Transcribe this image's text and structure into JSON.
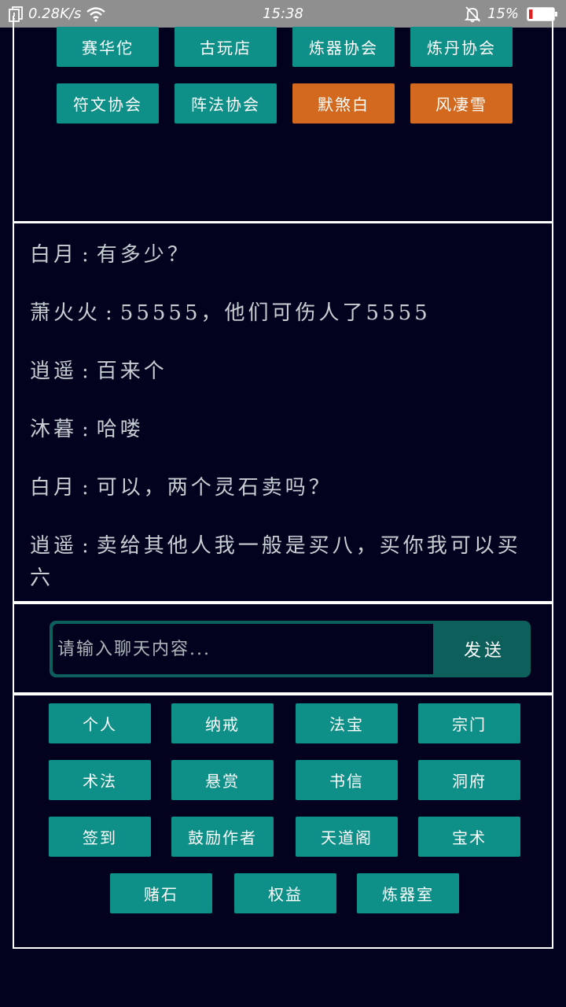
{
  "status_bar": {
    "speed": "0.28K/s",
    "time": "15:38",
    "battery_pct": "15%",
    "battery_level": 0.15,
    "battery_color": "#e02020",
    "icons": [
      "data-saver-icon",
      "wifi-icon",
      "bell-muted-icon",
      "battery-icon"
    ]
  },
  "top_buttons": [
    {
      "label": "赛华佗",
      "color": "#0e8f87"
    },
    {
      "label": "古玩店",
      "color": "#0e8f87"
    },
    {
      "label": "炼器协会",
      "color": "#0e8f87"
    },
    {
      "label": "炼丹协会",
      "color": "#0e8f87"
    },
    {
      "label": "符文协会",
      "color": "#0e8f87"
    },
    {
      "label": "阵法协会",
      "color": "#0e8f87"
    },
    {
      "label": "默煞白",
      "color": "#d2691e"
    },
    {
      "label": "风凄雪",
      "color": "#d2691e"
    }
  ],
  "chat": {
    "separator": ":",
    "messages": [
      {
        "speaker": "白月",
        "text": "有多少？"
      },
      {
        "speaker": "萧火火",
        "text": "55555，他们可伤人了5555"
      },
      {
        "speaker": "逍遥",
        "text": "百来个"
      },
      {
        "speaker": "沐暮",
        "text": "哈喽"
      },
      {
        "speaker": "白月",
        "text": "可以，两个灵石卖吗？"
      },
      {
        "speaker": "逍遥",
        "text": "卖给其他人我一般是买八，买你我可以买六"
      }
    ]
  },
  "input": {
    "placeholder": "请输入聊天内容...",
    "value": "",
    "send_label": "发送"
  },
  "menu_buttons": [
    {
      "label": "个人"
    },
    {
      "label": "纳戒"
    },
    {
      "label": "法宝"
    },
    {
      "label": "宗门"
    },
    {
      "label": "术法"
    },
    {
      "label": "悬赏"
    },
    {
      "label": "书信"
    },
    {
      "label": "洞府"
    },
    {
      "label": "签到"
    },
    {
      "label": "鼓励作者"
    },
    {
      "label": "天道阁"
    },
    {
      "label": "宝术"
    },
    {
      "label": "赌石"
    },
    {
      "label": "权益"
    },
    {
      "label": "炼器室"
    }
  ],
  "colors": {
    "background": "#02021f",
    "accent": "#0e8f87",
    "highlight": "#d2691e",
    "input_frame": "#0c5f5b"
  }
}
